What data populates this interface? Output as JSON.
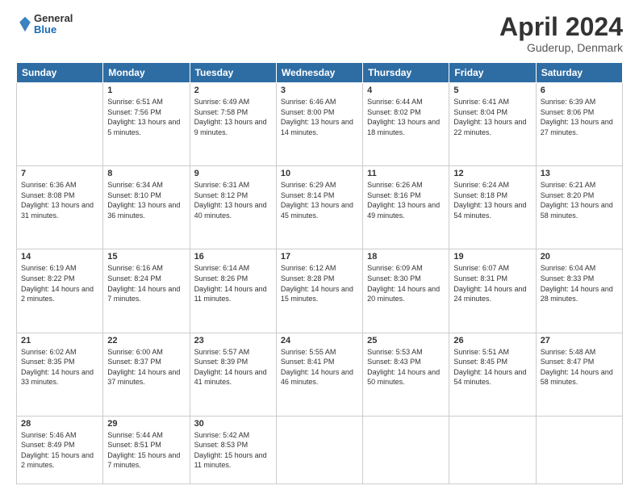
{
  "header": {
    "logo": {
      "general": "General",
      "blue": "Blue"
    },
    "title": "April 2024",
    "location": "Guderup, Denmark"
  },
  "weekdays": [
    "Sunday",
    "Monday",
    "Tuesday",
    "Wednesday",
    "Thursday",
    "Friday",
    "Saturday"
  ],
  "weeks": [
    [
      {
        "day": "",
        "sunrise": "",
        "sunset": "",
        "daylight": ""
      },
      {
        "day": "1",
        "sunrise": "Sunrise: 6:51 AM",
        "sunset": "Sunset: 7:56 PM",
        "daylight": "Daylight: 13 hours and 5 minutes."
      },
      {
        "day": "2",
        "sunrise": "Sunrise: 6:49 AM",
        "sunset": "Sunset: 7:58 PM",
        "daylight": "Daylight: 13 hours and 9 minutes."
      },
      {
        "day": "3",
        "sunrise": "Sunrise: 6:46 AM",
        "sunset": "Sunset: 8:00 PM",
        "daylight": "Daylight: 13 hours and 14 minutes."
      },
      {
        "day": "4",
        "sunrise": "Sunrise: 6:44 AM",
        "sunset": "Sunset: 8:02 PM",
        "daylight": "Daylight: 13 hours and 18 minutes."
      },
      {
        "day": "5",
        "sunrise": "Sunrise: 6:41 AM",
        "sunset": "Sunset: 8:04 PM",
        "daylight": "Daylight: 13 hours and 22 minutes."
      },
      {
        "day": "6",
        "sunrise": "Sunrise: 6:39 AM",
        "sunset": "Sunset: 8:06 PM",
        "daylight": "Daylight: 13 hours and 27 minutes."
      }
    ],
    [
      {
        "day": "7",
        "sunrise": "Sunrise: 6:36 AM",
        "sunset": "Sunset: 8:08 PM",
        "daylight": "Daylight: 13 hours and 31 minutes."
      },
      {
        "day": "8",
        "sunrise": "Sunrise: 6:34 AM",
        "sunset": "Sunset: 8:10 PM",
        "daylight": "Daylight: 13 hours and 36 minutes."
      },
      {
        "day": "9",
        "sunrise": "Sunrise: 6:31 AM",
        "sunset": "Sunset: 8:12 PM",
        "daylight": "Daylight: 13 hours and 40 minutes."
      },
      {
        "day": "10",
        "sunrise": "Sunrise: 6:29 AM",
        "sunset": "Sunset: 8:14 PM",
        "daylight": "Daylight: 13 hours and 45 minutes."
      },
      {
        "day": "11",
        "sunrise": "Sunrise: 6:26 AM",
        "sunset": "Sunset: 8:16 PM",
        "daylight": "Daylight: 13 hours and 49 minutes."
      },
      {
        "day": "12",
        "sunrise": "Sunrise: 6:24 AM",
        "sunset": "Sunset: 8:18 PM",
        "daylight": "Daylight: 13 hours and 54 minutes."
      },
      {
        "day": "13",
        "sunrise": "Sunrise: 6:21 AM",
        "sunset": "Sunset: 8:20 PM",
        "daylight": "Daylight: 13 hours and 58 minutes."
      }
    ],
    [
      {
        "day": "14",
        "sunrise": "Sunrise: 6:19 AM",
        "sunset": "Sunset: 8:22 PM",
        "daylight": "Daylight: 14 hours and 2 minutes."
      },
      {
        "day": "15",
        "sunrise": "Sunrise: 6:16 AM",
        "sunset": "Sunset: 8:24 PM",
        "daylight": "Daylight: 14 hours and 7 minutes."
      },
      {
        "day": "16",
        "sunrise": "Sunrise: 6:14 AM",
        "sunset": "Sunset: 8:26 PM",
        "daylight": "Daylight: 14 hours and 11 minutes."
      },
      {
        "day": "17",
        "sunrise": "Sunrise: 6:12 AM",
        "sunset": "Sunset: 8:28 PM",
        "daylight": "Daylight: 14 hours and 15 minutes."
      },
      {
        "day": "18",
        "sunrise": "Sunrise: 6:09 AM",
        "sunset": "Sunset: 8:30 PM",
        "daylight": "Daylight: 14 hours and 20 minutes."
      },
      {
        "day": "19",
        "sunrise": "Sunrise: 6:07 AM",
        "sunset": "Sunset: 8:31 PM",
        "daylight": "Daylight: 14 hours and 24 minutes."
      },
      {
        "day": "20",
        "sunrise": "Sunrise: 6:04 AM",
        "sunset": "Sunset: 8:33 PM",
        "daylight": "Daylight: 14 hours and 28 minutes."
      }
    ],
    [
      {
        "day": "21",
        "sunrise": "Sunrise: 6:02 AM",
        "sunset": "Sunset: 8:35 PM",
        "daylight": "Daylight: 14 hours and 33 minutes."
      },
      {
        "day": "22",
        "sunrise": "Sunrise: 6:00 AM",
        "sunset": "Sunset: 8:37 PM",
        "daylight": "Daylight: 14 hours and 37 minutes."
      },
      {
        "day": "23",
        "sunrise": "Sunrise: 5:57 AM",
        "sunset": "Sunset: 8:39 PM",
        "daylight": "Daylight: 14 hours and 41 minutes."
      },
      {
        "day": "24",
        "sunrise": "Sunrise: 5:55 AM",
        "sunset": "Sunset: 8:41 PM",
        "daylight": "Daylight: 14 hours and 46 minutes."
      },
      {
        "day": "25",
        "sunrise": "Sunrise: 5:53 AM",
        "sunset": "Sunset: 8:43 PM",
        "daylight": "Daylight: 14 hours and 50 minutes."
      },
      {
        "day": "26",
        "sunrise": "Sunrise: 5:51 AM",
        "sunset": "Sunset: 8:45 PM",
        "daylight": "Daylight: 14 hours and 54 minutes."
      },
      {
        "day": "27",
        "sunrise": "Sunrise: 5:48 AM",
        "sunset": "Sunset: 8:47 PM",
        "daylight": "Daylight: 14 hours and 58 minutes."
      }
    ],
    [
      {
        "day": "28",
        "sunrise": "Sunrise: 5:46 AM",
        "sunset": "Sunset: 8:49 PM",
        "daylight": "Daylight: 15 hours and 2 minutes."
      },
      {
        "day": "29",
        "sunrise": "Sunrise: 5:44 AM",
        "sunset": "Sunset: 8:51 PM",
        "daylight": "Daylight: 15 hours and 7 minutes."
      },
      {
        "day": "30",
        "sunrise": "Sunrise: 5:42 AM",
        "sunset": "Sunset: 8:53 PM",
        "daylight": "Daylight: 15 hours and 11 minutes."
      },
      {
        "day": "",
        "sunrise": "",
        "sunset": "",
        "daylight": ""
      },
      {
        "day": "",
        "sunrise": "",
        "sunset": "",
        "daylight": ""
      },
      {
        "day": "",
        "sunrise": "",
        "sunset": "",
        "daylight": ""
      },
      {
        "day": "",
        "sunrise": "",
        "sunset": "",
        "daylight": ""
      }
    ]
  ]
}
